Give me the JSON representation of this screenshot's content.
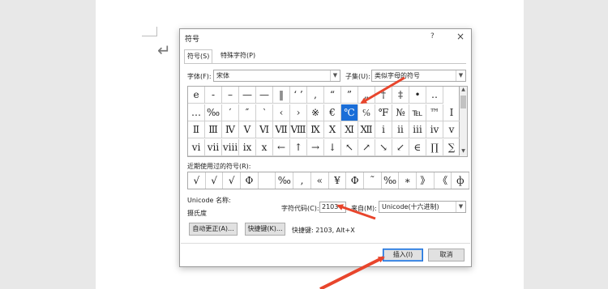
{
  "dialog": {
    "title": "符号",
    "help": "?",
    "close": "×",
    "tabs": [
      "符号(S)",
      "特殊字符(P)"
    ],
    "font_label": "字体(F):",
    "font_value": "宋体",
    "subset_label": "子集(U):",
    "subset_value": "类似字母的符号",
    "symbols": [
      [
        "e",
        "-",
        "–",
        "—",
        "—",
        "‖",
        "‘ ’",
        ",",
        "“",
        "”",
        "„",
        "†",
        "‡",
        "•",
        "‥"
      ],
      [
        "…",
        "‰",
        "′",
        "″",
        "‵",
        "‹",
        "›",
        "※",
        "€",
        "℃",
        "℅",
        "℉",
        "№",
        "℡",
        "™",
        "Ⅰ"
      ],
      [
        "Ⅱ",
        "Ⅲ",
        "Ⅳ",
        "Ⅴ",
        "Ⅵ",
        "Ⅶ",
        "Ⅷ",
        "Ⅸ",
        "Ⅹ",
        "Ⅺ",
        "Ⅻ",
        "ⅰ",
        "ⅱ",
        "ⅲ",
        "ⅳ",
        "ⅴ"
      ],
      [
        "ⅵ",
        "ⅶ",
        "ⅷ",
        "ⅸ",
        "ⅹ",
        "←",
        "↑",
        "→",
        "↓",
        "↖",
        "↗",
        "↘",
        "↙",
        "∈",
        "∏",
        "∑"
      ]
    ],
    "recent_label": "近期使用过的符号(R):",
    "recent_symbols": [
      "√",
      "√",
      "√",
      "Φ",
      "",
      "‰",
      ",",
      "«",
      "¥",
      "Φ",
      "˜",
      "‰",
      "∗",
      "》",
      "《",
      "ф"
    ],
    "unicode_name_label": "Unicode 名称:",
    "unicode_name_value": "摄氏度",
    "char_code_label": "字符代码(C):",
    "char_code_value": "2103",
    "from_label": "来自(M):",
    "from_value": "Unicode(十六进制)",
    "autocorrect_btn": "自动更正(A)...",
    "shortcut_btn": "快捷键(K)...",
    "shortcut_text": "快捷键: 2103, Alt+X",
    "insert_btn": "插入(I)",
    "cancel_btn": "取消"
  },
  "document": {
    "paragraph_mark": "↵"
  },
  "colors": {
    "selection": "#1a6ed8",
    "annotation_arrow": "#e8452c"
  }
}
